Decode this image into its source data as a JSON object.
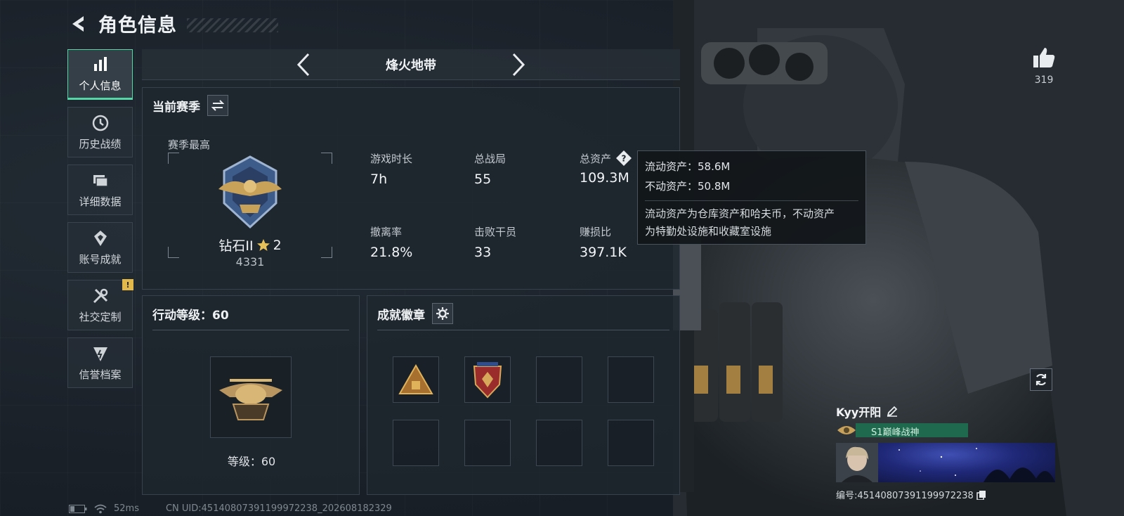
{
  "header": {
    "title": "角色信息"
  },
  "sidebar": {
    "items": [
      {
        "label": "个人信息",
        "icon": "bar-chart-icon",
        "active": true
      },
      {
        "label": "历史战绩",
        "icon": "history-icon"
      },
      {
        "label": "详细数据",
        "icon": "folders-icon"
      },
      {
        "label": "账号成就",
        "icon": "achievement-icon"
      },
      {
        "label": "社交定制",
        "icon": "tools-icon",
        "badge": "!"
      },
      {
        "label": "信誉档案",
        "icon": "reputation-icon"
      }
    ]
  },
  "mode": {
    "title": "烽火地带"
  },
  "season": {
    "title": "当前赛季",
    "best_label": "赛季最高",
    "rank_name": "钻石II",
    "rank_stars": "2",
    "rank_score": "4331",
    "stats": [
      {
        "label": "游戏时长",
        "value": "7h"
      },
      {
        "label": "总战局",
        "value": "55"
      },
      {
        "label": "总资产",
        "value": "109.3M"
      },
      {
        "label": "撤离率",
        "value": "21.8%"
      },
      {
        "label": "击败干员",
        "value": "33"
      },
      {
        "label": "赚损比",
        "value": "397.1K"
      }
    ]
  },
  "tooltip": {
    "liquid": "流动资产：58.6M",
    "fixed": "不动资产：50.8M",
    "note_line1": "流动资产为仓库资产和哈夫币，不动资产",
    "note_line2": "为特勤处设施和收藏室设施"
  },
  "action_level": {
    "title": "行动等级：60",
    "level_text": "等级：60"
  },
  "badges": {
    "title": "成就徽章"
  },
  "likes": {
    "count": "319"
  },
  "player": {
    "name": "Kyy开阳",
    "title_tag": "S1巅峰战神",
    "uid": "编号:45140807391199972238"
  },
  "footer": {
    "ping": "52ms",
    "cn_uid": "CN UID:45140807391199972238_202608182329"
  },
  "colors": {
    "accent": "#55d6a6",
    "badge": "#e3b84a",
    "title_tag": "#1f6a4e"
  }
}
